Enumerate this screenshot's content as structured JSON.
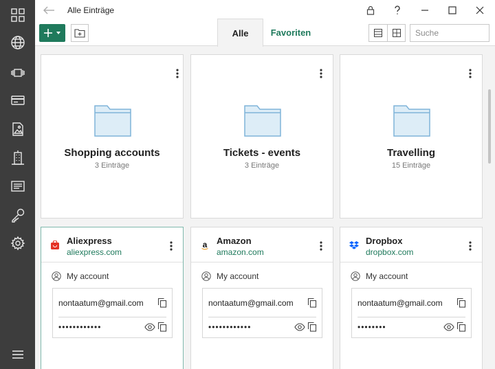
{
  "window": {
    "title": "Alle Einträge"
  },
  "toolbar": {
    "tab_all": "Alle",
    "tab_favorites": "Favoriten",
    "search_placeholder": "Suche"
  },
  "folders": [
    {
      "name": "Shopping accounts",
      "count": "3 Einträge"
    },
    {
      "name": "Tickets - events",
      "count": "3 Einträge"
    },
    {
      "name": "Travelling",
      "count": "15 Einträge"
    }
  ],
  "accounts": [
    {
      "name": "Aliexpress",
      "url": "aliexpress.com",
      "user_label": "My account",
      "email": "nontaatum@gmail.com",
      "password_mask": "••••••••••••",
      "logo": "aliexpress-logo",
      "selected": true
    },
    {
      "name": "Amazon",
      "url": "amazon.com",
      "user_label": "My account",
      "email": "nontaatum@gmail.com",
      "password_mask": "••••••••••••",
      "logo": "amazon-logo",
      "selected": false
    },
    {
      "name": "Dropbox",
      "url": "dropbox.com",
      "user_label": "My account",
      "email": "nontaatum@gmail.com",
      "password_mask": "••••••••",
      "logo": "dropbox-logo",
      "selected": false
    }
  ],
  "colors": {
    "accent": "#1f7a5c",
    "sidebar": "#3d3d3d",
    "aliexpress": "#e43225",
    "dropbox": "#0061fe"
  }
}
